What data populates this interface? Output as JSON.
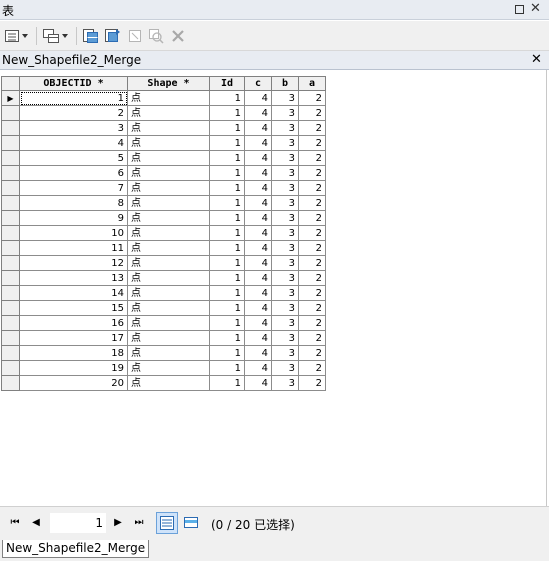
{
  "window": {
    "title": "表"
  },
  "toolbar": {
    "buttons": [
      {
        "name": "table-options-icon",
        "enabled": true,
        "dropdown": true
      },
      {
        "name": "related-tables-icon",
        "enabled": true,
        "dropdown": true
      },
      {
        "name": "select-by-attributes-icon",
        "enabled": true
      },
      {
        "name": "switch-selection-icon",
        "enabled": true
      },
      {
        "name": "clear-selection-icon",
        "enabled": false
      },
      {
        "name": "zoom-to-selected-icon",
        "enabled": false
      },
      {
        "name": "delete-selected-icon",
        "enabled": false
      }
    ]
  },
  "table_tab": {
    "title": "New_Shapefile2_Merge"
  },
  "grid": {
    "columns": [
      "OBJECTID *",
      "Shape *",
      "Id",
      "c",
      "b",
      "a"
    ],
    "rows": [
      [
        "1",
        "点",
        "1",
        "4",
        "3",
        "2"
      ],
      [
        "2",
        "点",
        "1",
        "4",
        "3",
        "2"
      ],
      [
        "3",
        "点",
        "1",
        "4",
        "3",
        "2"
      ],
      [
        "4",
        "点",
        "1",
        "4",
        "3",
        "2"
      ],
      [
        "5",
        "点",
        "1",
        "4",
        "3",
        "2"
      ],
      [
        "6",
        "点",
        "1",
        "4",
        "3",
        "2"
      ],
      [
        "7",
        "点",
        "1",
        "4",
        "3",
        "2"
      ],
      [
        "8",
        "点",
        "1",
        "4",
        "3",
        "2"
      ],
      [
        "9",
        "点",
        "1",
        "4",
        "3",
        "2"
      ],
      [
        "10",
        "点",
        "1",
        "4",
        "3",
        "2"
      ],
      [
        "11",
        "点",
        "1",
        "4",
        "3",
        "2"
      ],
      [
        "12",
        "点",
        "1",
        "4",
        "3",
        "2"
      ],
      [
        "13",
        "点",
        "1",
        "4",
        "3",
        "2"
      ],
      [
        "14",
        "点",
        "1",
        "4",
        "3",
        "2"
      ],
      [
        "15",
        "点",
        "1",
        "4",
        "3",
        "2"
      ],
      [
        "16",
        "点",
        "1",
        "4",
        "3",
        "2"
      ],
      [
        "17",
        "点",
        "1",
        "4",
        "3",
        "2"
      ],
      [
        "18",
        "点",
        "1",
        "4",
        "3",
        "2"
      ],
      [
        "19",
        "点",
        "1",
        "4",
        "3",
        "2"
      ],
      [
        "20",
        "点",
        "1",
        "4",
        "3",
        "2"
      ]
    ],
    "current_row": 1
  },
  "status": {
    "record_value": "1",
    "selection_text": "(0 / 20 已选择)",
    "nav_first": "⏮",
    "nav_prev": "◀",
    "nav_next": "▶",
    "nav_last": "⏭"
  },
  "bottom_tabs": [
    {
      "label": "New_Shapefile2_Merge"
    }
  ],
  "colors": {
    "accent": "#2b6bb3",
    "header_bg": "#f0f0f0",
    "grid_line": "#8c8c8c"
  }
}
